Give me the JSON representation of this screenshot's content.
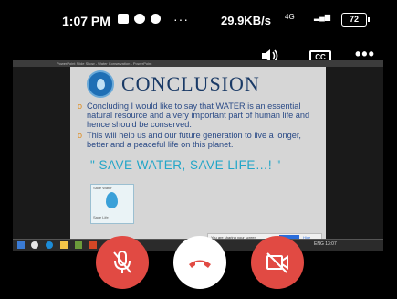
{
  "status_bar": {
    "time": "1:07 PM",
    "overflow": "···",
    "network_speed": "29.9KB/s",
    "battery": "72",
    "signal_label": "4G"
  },
  "call_toolbar": {
    "cc_label": "CC",
    "more": "•••"
  },
  "shared_screen": {
    "window_title": "PowerPoint Slide Show - Water Conservation - PowerPoint",
    "slide": {
      "title": "CONCLUSION",
      "bullets": [
        "Concluding I would like to say that WATER is an essential natural resource and a very important part of human life and hence should be conserved.",
        "This will help us and our future generation to live a longer, better and a peaceful life on this planet."
      ],
      "slogan": "\" SAVE WATER, SAVE LIFE…! \"",
      "stamp_top": "Save Water",
      "stamp_bottom": "Save Life"
    },
    "share_notice": "You are sharing your screen",
    "share_stop": "Stop sharing",
    "share_hide": "Hide",
    "tray_text": "ENG 13:07"
  },
  "colors": {
    "end_call_bg": "#ffffff",
    "control_red": "#e14a43",
    "slide_title": "#1a3a66",
    "slogan": "#22a6c8"
  }
}
